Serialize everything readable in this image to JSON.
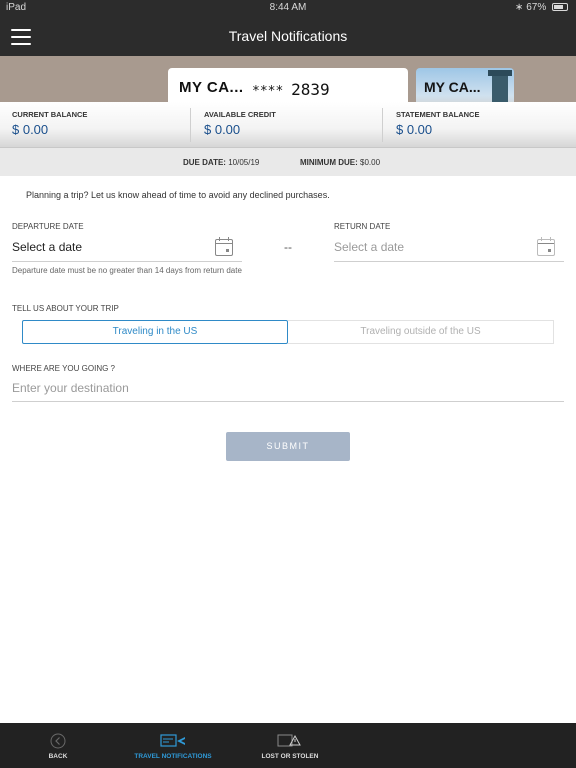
{
  "status_bar": {
    "device": "iPad",
    "time": "8:44 AM",
    "battery": "67%"
  },
  "nav": {
    "title": "Travel Notifications"
  },
  "cards": {
    "primary": {
      "name": "MY CA...",
      "mask": "****",
      "last4": "2839"
    },
    "secondary": {
      "name": "MY CA..."
    }
  },
  "balances": [
    {
      "label": "CURRENT BALANCE",
      "value": "$ 0.00"
    },
    {
      "label": "AVAILABLE CREDIT",
      "value": "$ 0.00"
    },
    {
      "label": "STATEMENT BALANCE",
      "value": "$ 0.00"
    }
  ],
  "due": {
    "due_label": "DUE DATE:",
    "due_value": "10/05/19",
    "min_label": "MINIMUM DUE:",
    "min_value": "$0.00"
  },
  "intro": "Planning a trip? Let us know ahead of time to avoid any declined purchases.",
  "departure": {
    "label": "DEPARTURE DATE",
    "value": "Select a date",
    "hint": "Departure date must be no greater than 14 days from return date"
  },
  "separator": "--",
  "return": {
    "label": "RETURN DATE",
    "value": "Select a date"
  },
  "trip": {
    "label": "TELL US ABOUT YOUR TRIP",
    "options": [
      "Traveling in the US",
      "Traveling outside of the US"
    ],
    "selected": "Traveling in the US"
  },
  "destination": {
    "label": "WHERE ARE YOU GOING ?",
    "placeholder": "Enter your destination",
    "value": ""
  },
  "submit_label": "SUBMIT",
  "tabs": [
    {
      "label": "BACK",
      "icon": "back-icon"
    },
    {
      "label": "TRAVEL NOTIFICATIONS",
      "icon": "travel-icon",
      "active": true
    },
    {
      "label": "LOST OR STOLEN",
      "icon": "lost-card-icon"
    }
  ],
  "colors": {
    "accent": "#2f8ac7",
    "balance_value": "#1a4f8c",
    "submit_bg": "#a7b5c8",
    "nav_bg": "#2c2c2c"
  }
}
